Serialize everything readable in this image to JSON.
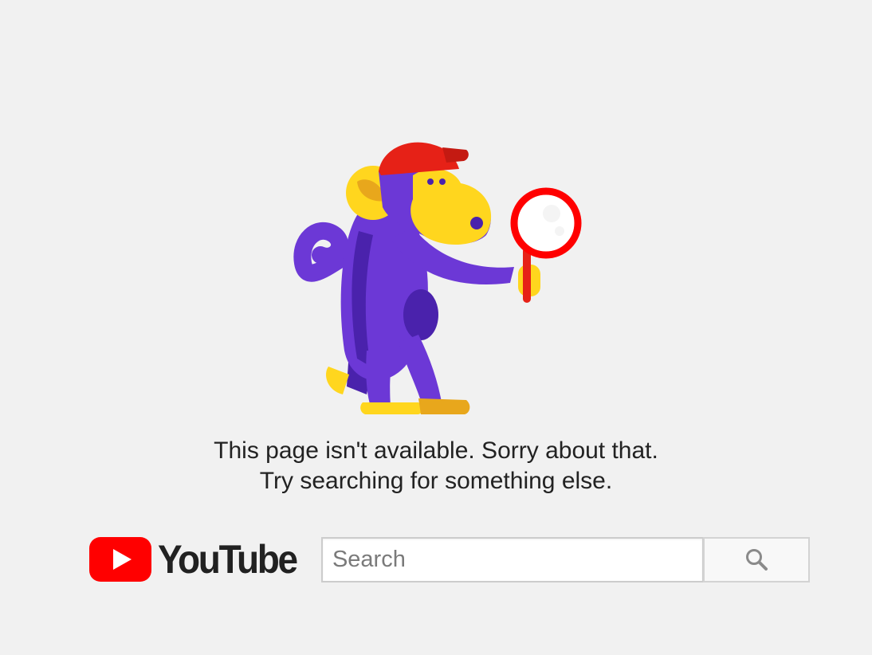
{
  "illustration": {
    "name": "monkey-with-magnifying-glass",
    "colors": {
      "body": "#6c38d6",
      "body_dark": "#4a22ac",
      "face": "#ffd61e",
      "hat": "#e62117",
      "magnifier": "#ff0000",
      "feet_shadow": "#e8a71c"
    }
  },
  "message": {
    "line1": "This page isn't available. Sorry about that.",
    "line2": "Try searching for something else."
  },
  "logo": {
    "wordmark": "YouTube",
    "brand_color": "#ff0000"
  },
  "search": {
    "placeholder": "Search",
    "value": "",
    "button_icon": "search-icon"
  }
}
